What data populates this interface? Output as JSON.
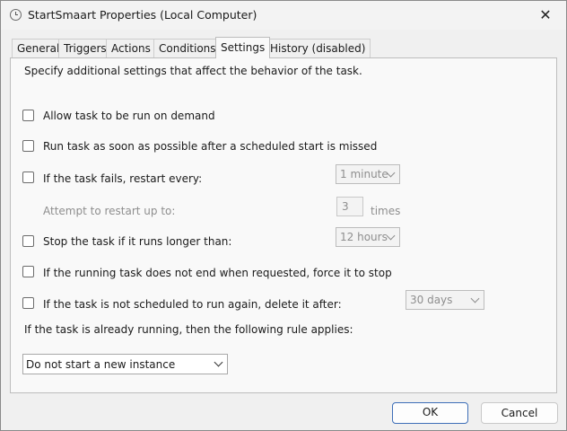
{
  "window": {
    "title": "StartSmaart Properties (Local Computer)",
    "close_symbol": "✕"
  },
  "tabs": [
    {
      "label": "General",
      "active": false
    },
    {
      "label": "Triggers",
      "active": false
    },
    {
      "label": "Actions",
      "active": false
    },
    {
      "label": "Conditions",
      "active": false
    },
    {
      "label": "Settings",
      "active": true
    },
    {
      "label": "History (disabled)",
      "active": false
    }
  ],
  "settings": {
    "description": "Specify additional settings that affect the behavior of the task.",
    "allow_on_demand": {
      "label": "Allow task to be run on demand",
      "checked": false
    },
    "run_asap": {
      "label": "Run task as soon as possible after a scheduled start is missed",
      "checked": false
    },
    "restart_on_fail": {
      "label": "If the task fails, restart every:",
      "checked": false,
      "interval": "1 minute"
    },
    "restart_attempts": {
      "label": "Attempt to restart up to:",
      "value": "3",
      "unit": "times"
    },
    "stop_if_longer": {
      "label": "Stop the task if it runs longer than:",
      "checked": false,
      "duration": "12 hours"
    },
    "force_stop": {
      "label": "If the running task does not end when requested, force it to stop",
      "checked": false
    },
    "delete_if_not_scheduled": {
      "label": "If the task is not scheduled to run again, delete it after:",
      "checked": false,
      "duration": "30 days"
    },
    "running_rule": {
      "label": "If the task is already running, then the following rule applies:",
      "value": "Do not start a new instance"
    }
  },
  "buttons": {
    "ok": "OK",
    "cancel": "Cancel"
  }
}
